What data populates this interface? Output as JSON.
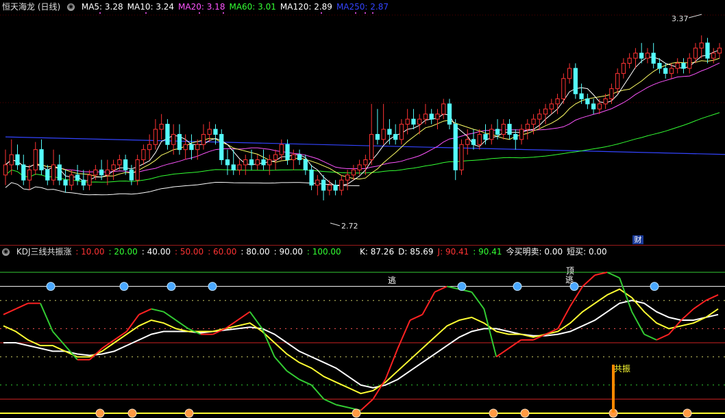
{
  "main_header": {
    "title": "恒天海龙 (日线)",
    "indicators": [
      {
        "label": "MA5: 3.28",
        "color": "#ffffff"
      },
      {
        "label": "MA10: 3.24",
        "color": "#ffffff"
      },
      {
        "label": "MA20: 3.18",
        "color": "#ff55ff"
      },
      {
        "label": "MA60: 3.01",
        "color": "#33ff33"
      },
      {
        "label": "MA120: 2.89",
        "color": "#ffffff"
      },
      {
        "label": "MA250: 2.87",
        "color": "#3344ff"
      }
    ]
  },
  "price_annotations": {
    "high": "3.37",
    "low": "2.72",
    "finance_badge": "财"
  },
  "kdj_header": {
    "title": "KDJ三线共振涨",
    "levels": [
      {
        "label": ": 10.00",
        "color": "#ff3333"
      },
      {
        "label": ": 20.00",
        "color": "#33ff33"
      },
      {
        "label": ": 40.00",
        "color": "#ffffff"
      },
      {
        "label": ": 50.00",
        "color": "#ff3333"
      },
      {
        "label": ": 60.00",
        "color": "#ff3333"
      },
      {
        "label": ": 80.00",
        "color": "#ffffff"
      },
      {
        "label": ": 90.00",
        "color": "#ffffff"
      },
      {
        "label": ": 100.00",
        "color": "#33ff33"
      }
    ],
    "values": [
      {
        "label": "K: 87.26",
        "color": "#ffffff"
      },
      {
        "label": "D: 85.69",
        "color": "#ffffff"
      },
      {
        "label": "J: 90.41",
        "color": "#ff3333"
      },
      {
        "label": ": 90.41",
        "color": "#33ff33"
      },
      {
        "label": "今买明卖: 0.00",
        "color": "#ffffff"
      },
      {
        "label": "短买: 0.00",
        "color": "#ffffff"
      }
    ]
  },
  "kdj_labels": {
    "escape": "逃",
    "top": "顶",
    "top_escape": "逃",
    "resonance": "共振"
  },
  "colors": {
    "up": "#ff3333",
    "down": "#55ffff",
    "ma5": "#ffffff",
    "ma10": "#ffff66",
    "ma20": "#ff55ff",
    "ma60": "#33ff33",
    "ma120": "#ffffff",
    "ma250": "#3344ff",
    "k": "#ffff33",
    "d": "#ffffff",
    "j": "#ff2222",
    "j_down": "#33cc33"
  },
  "chart_data": [
    {
      "type": "candlestick",
      "title": "恒天海龙 (日线)",
      "ylim": [
        2.62,
        3.45
      ],
      "series": [
        {
          "name": "MA250",
          "x": [
            0,
            139
          ],
          "values": [
            2.97,
            2.89
          ]
        }
      ],
      "candles": [
        {
          "o": 2.82,
          "h": 2.92,
          "l": 2.78,
          "c": 2.86
        },
        {
          "o": 2.86,
          "h": 2.96,
          "l": 2.82,
          "c": 2.9
        },
        {
          "o": 2.9,
          "h": 2.94,
          "l": 2.84,
          "c": 2.86
        },
        {
          "o": 2.86,
          "h": 2.9,
          "l": 2.78,
          "c": 2.8
        },
        {
          "o": 2.8,
          "h": 2.86,
          "l": 2.76,
          "c": 2.84
        },
        {
          "o": 2.84,
          "h": 2.95,
          "l": 2.82,
          "c": 2.92
        },
        {
          "o": 2.92,
          "h": 2.96,
          "l": 2.82,
          "c": 2.84
        },
        {
          "o": 2.84,
          "h": 2.86,
          "l": 2.78,
          "c": 2.8
        },
        {
          "o": 2.8,
          "h": 2.92,
          "l": 2.78,
          "c": 2.86
        },
        {
          "o": 2.86,
          "h": 2.9,
          "l": 2.78,
          "c": 2.8
        },
        {
          "o": 2.8,
          "h": 2.84,
          "l": 2.75,
          "c": 2.78
        },
        {
          "o": 2.78,
          "h": 2.84,
          "l": 2.76,
          "c": 2.82
        },
        {
          "o": 2.82,
          "h": 2.86,
          "l": 2.78,
          "c": 2.8
        },
        {
          "o": 2.8,
          "h": 2.84,
          "l": 2.76,
          "c": 2.78
        },
        {
          "o": 2.78,
          "h": 2.84,
          "l": 2.76,
          "c": 2.82
        },
        {
          "o": 2.82,
          "h": 2.86,
          "l": 2.8,
          "c": 2.84
        },
        {
          "o": 2.84,
          "h": 2.88,
          "l": 2.8,
          "c": 2.82
        },
        {
          "o": 2.82,
          "h": 2.88,
          "l": 2.78,
          "c": 2.84
        },
        {
          "o": 2.84,
          "h": 2.88,
          "l": 2.8,
          "c": 2.86
        },
        {
          "o": 2.86,
          "h": 2.9,
          "l": 2.84,
          "c": 2.88
        },
        {
          "o": 2.88,
          "h": 2.9,
          "l": 2.82,
          "c": 2.84
        },
        {
          "o": 2.84,
          "h": 2.86,
          "l": 2.78,
          "c": 2.8
        },
        {
          "o": 2.8,
          "h": 2.9,
          "l": 2.78,
          "c": 2.88
        },
        {
          "o": 2.88,
          "h": 2.94,
          "l": 2.86,
          "c": 2.92
        },
        {
          "o": 2.92,
          "h": 2.98,
          "l": 2.88,
          "c": 2.94
        },
        {
          "o": 2.94,
          "h": 3.04,
          "l": 2.92,
          "c": 3.0
        },
        {
          "o": 3.0,
          "h": 3.06,
          "l": 2.96,
          "c": 3.02
        },
        {
          "o": 3.02,
          "h": 3.04,
          "l": 2.92,
          "c": 2.94
        },
        {
          "o": 2.94,
          "h": 3.02,
          "l": 2.9,
          "c": 2.98
        },
        {
          "o": 2.98,
          "h": 3.02,
          "l": 2.9,
          "c": 2.92
        },
        {
          "o": 2.92,
          "h": 2.98,
          "l": 2.88,
          "c": 2.94
        },
        {
          "o": 2.94,
          "h": 2.98,
          "l": 2.88,
          "c": 2.92
        },
        {
          "o": 2.92,
          "h": 2.96,
          "l": 2.88,
          "c": 2.94
        },
        {
          "o": 2.94,
          "h": 3.02,
          "l": 2.92,
          "c": 2.98
        },
        {
          "o": 2.98,
          "h": 3.03,
          "l": 2.95,
          "c": 3.0
        },
        {
          "o": 3.0,
          "h": 3.02,
          "l": 2.94,
          "c": 2.98
        },
        {
          "o": 2.98,
          "h": 3.0,
          "l": 2.86,
          "c": 2.88
        },
        {
          "o": 2.88,
          "h": 2.92,
          "l": 2.82,
          "c": 2.86
        },
        {
          "o": 2.86,
          "h": 2.92,
          "l": 2.82,
          "c": 2.84
        },
        {
          "o": 2.84,
          "h": 2.88,
          "l": 2.82,
          "c": 2.86
        },
        {
          "o": 2.86,
          "h": 2.9,
          "l": 2.82,
          "c": 2.88
        },
        {
          "o": 2.88,
          "h": 2.92,
          "l": 2.84,
          "c": 2.86
        },
        {
          "o": 2.86,
          "h": 2.9,
          "l": 2.84,
          "c": 2.88
        },
        {
          "o": 2.88,
          "h": 2.92,
          "l": 2.84,
          "c": 2.86
        },
        {
          "o": 2.86,
          "h": 2.9,
          "l": 2.82,
          "c": 2.88
        },
        {
          "o": 2.88,
          "h": 2.92,
          "l": 2.84,
          "c": 2.9
        },
        {
          "o": 2.9,
          "h": 2.96,
          "l": 2.88,
          "c": 2.94
        },
        {
          "o": 2.94,
          "h": 2.96,
          "l": 2.86,
          "c": 2.88
        },
        {
          "o": 2.88,
          "h": 2.92,
          "l": 2.84,
          "c": 2.9
        },
        {
          "o": 2.9,
          "h": 2.92,
          "l": 2.86,
          "c": 2.88
        },
        {
          "o": 2.88,
          "h": 2.9,
          "l": 2.82,
          "c": 2.84
        },
        {
          "o": 2.84,
          "h": 2.86,
          "l": 2.76,
          "c": 2.78
        },
        {
          "o": 2.78,
          "h": 2.82,
          "l": 2.74,
          "c": 2.8
        },
        {
          "o": 2.8,
          "h": 2.82,
          "l": 2.72,
          "c": 2.76
        },
        {
          "o": 2.76,
          "h": 2.8,
          "l": 2.74,
          "c": 2.78
        },
        {
          "o": 2.78,
          "h": 2.8,
          "l": 2.74,
          "c": 2.76
        },
        {
          "o": 2.76,
          "h": 2.82,
          "l": 2.74,
          "c": 2.8
        },
        {
          "o": 2.8,
          "h": 2.84,
          "l": 2.76,
          "c": 2.82
        },
        {
          "o": 2.82,
          "h": 2.86,
          "l": 2.8,
          "c": 2.84
        },
        {
          "o": 2.84,
          "h": 2.88,
          "l": 2.82,
          "c": 2.86
        },
        {
          "o": 2.86,
          "h": 2.9,
          "l": 2.82,
          "c": 2.88
        },
        {
          "o": 2.88,
          "h": 3.1,
          "l": 2.86,
          "c": 2.98
        },
        {
          "o": 2.98,
          "h": 3.08,
          "l": 2.94,
          "c": 2.96
        },
        {
          "o": 2.96,
          "h": 3.1,
          "l": 2.94,
          "c": 3.0
        },
        {
          "o": 3.0,
          "h": 3.04,
          "l": 2.94,
          "c": 2.98
        },
        {
          "o": 2.98,
          "h": 3.02,
          "l": 2.94,
          "c": 2.96
        },
        {
          "o": 2.96,
          "h": 3.04,
          "l": 2.94,
          "c": 3.02
        },
        {
          "o": 3.02,
          "h": 3.08,
          "l": 2.98,
          "c": 3.04
        },
        {
          "o": 3.04,
          "h": 3.08,
          "l": 3.0,
          "c": 3.02
        },
        {
          "o": 3.02,
          "h": 3.06,
          "l": 2.98,
          "c": 3.04
        },
        {
          "o": 3.04,
          "h": 3.1,
          "l": 3.02,
          "c": 3.06
        },
        {
          "o": 3.06,
          "h": 3.08,
          "l": 3.02,
          "c": 3.04
        },
        {
          "o": 3.04,
          "h": 3.08,
          "l": 3.0,
          "c": 3.06
        },
        {
          "o": 3.06,
          "h": 3.12,
          "l": 3.04,
          "c": 3.1
        },
        {
          "o": 3.1,
          "h": 3.12,
          "l": 3.0,
          "c": 3.02
        },
        {
          "o": 3.02,
          "h": 3.04,
          "l": 2.8,
          "c": 2.84
        },
        {
          "o": 2.84,
          "h": 2.96,
          "l": 2.82,
          "c": 2.94
        },
        {
          "o": 2.94,
          "h": 3.0,
          "l": 2.9,
          "c": 2.96
        },
        {
          "o": 2.96,
          "h": 3.0,
          "l": 2.92,
          "c": 2.94
        },
        {
          "o": 2.94,
          "h": 3.0,
          "l": 2.92,
          "c": 2.98
        },
        {
          "o": 2.98,
          "h": 3.02,
          "l": 2.94,
          "c": 2.96
        },
        {
          "o": 2.96,
          "h": 3.02,
          "l": 2.94,
          "c": 3.0
        },
        {
          "o": 3.0,
          "h": 3.04,
          "l": 2.96,
          "c": 2.98
        },
        {
          "o": 2.98,
          "h": 3.04,
          "l": 2.96,
          "c": 3.02
        },
        {
          "o": 3.02,
          "h": 3.04,
          "l": 2.96,
          "c": 2.98
        },
        {
          "o": 2.98,
          "h": 3.0,
          "l": 2.92,
          "c": 2.96
        },
        {
          "o": 2.96,
          "h": 3.02,
          "l": 2.94,
          "c": 3.0
        },
        {
          "o": 3.0,
          "h": 3.04,
          "l": 2.96,
          "c": 3.02
        },
        {
          "o": 3.02,
          "h": 3.06,
          "l": 2.98,
          "c": 3.04
        },
        {
          "o": 3.04,
          "h": 3.08,
          "l": 3.0,
          "c": 3.06
        },
        {
          "o": 3.06,
          "h": 3.1,
          "l": 3.02,
          "c": 3.08
        },
        {
          "o": 3.08,
          "h": 3.12,
          "l": 3.06,
          "c": 3.1
        },
        {
          "o": 3.1,
          "h": 3.14,
          "l": 3.06,
          "c": 3.12
        },
        {
          "o": 3.12,
          "h": 3.22,
          "l": 3.1,
          "c": 3.2
        },
        {
          "o": 3.2,
          "h": 3.26,
          "l": 3.18,
          "c": 3.24
        },
        {
          "o": 3.24,
          "h": 3.26,
          "l": 3.12,
          "c": 3.14
        },
        {
          "o": 3.14,
          "h": 3.18,
          "l": 3.1,
          "c": 3.12
        },
        {
          "o": 3.12,
          "h": 3.14,
          "l": 3.08,
          "c": 3.1
        },
        {
          "o": 3.1,
          "h": 3.12,
          "l": 3.06,
          "c": 3.08
        },
        {
          "o": 3.08,
          "h": 3.12,
          "l": 3.06,
          "c": 3.1
        },
        {
          "o": 3.1,
          "h": 3.14,
          "l": 3.08,
          "c": 3.12
        },
        {
          "o": 3.12,
          "h": 3.18,
          "l": 3.1,
          "c": 3.16
        },
        {
          "o": 3.16,
          "h": 3.24,
          "l": 3.14,
          "c": 3.22
        },
        {
          "o": 3.22,
          "h": 3.28,
          "l": 3.2,
          "c": 3.26
        },
        {
          "o": 3.26,
          "h": 3.3,
          "l": 3.24,
          "c": 3.28
        },
        {
          "o": 3.28,
          "h": 3.32,
          "l": 3.24,
          "c": 3.3
        },
        {
          "o": 3.3,
          "h": 3.34,
          "l": 3.26,
          "c": 3.28
        },
        {
          "o": 3.28,
          "h": 3.32,
          "l": 3.26,
          "c": 3.3
        },
        {
          "o": 3.3,
          "h": 3.34,
          "l": 3.24,
          "c": 3.26
        },
        {
          "o": 3.26,
          "h": 3.28,
          "l": 3.22,
          "c": 3.24
        },
        {
          "o": 3.24,
          "h": 3.26,
          "l": 3.2,
          "c": 3.22
        },
        {
          "o": 3.22,
          "h": 3.26,
          "l": 3.2,
          "c": 3.24
        },
        {
          "o": 3.24,
          "h": 3.28,
          "l": 3.22,
          "c": 3.26
        },
        {
          "o": 3.26,
          "h": 3.28,
          "l": 3.22,
          "c": 3.24
        },
        {
          "o": 3.24,
          "h": 3.3,
          "l": 3.22,
          "c": 3.28
        },
        {
          "o": 3.28,
          "h": 3.34,
          "l": 3.26,
          "c": 3.32
        },
        {
          "o": 3.32,
          "h": 3.37,
          "l": 3.28,
          "c": 3.34
        },
        {
          "o": 3.34,
          "h": 3.36,
          "l": 3.26,
          "c": 3.28
        },
        {
          "o": 3.28,
          "h": 3.32,
          "l": 3.26,
          "c": 3.3
        },
        {
          "o": 3.3,
          "h": 3.34,
          "l": 3.28,
          "c": 3.32
        }
      ]
    },
    {
      "type": "line",
      "title": "KDJ三线共振涨",
      "ylim": [
        0,
        100
      ],
      "series": [
        {
          "name": "K",
          "values": [
            62,
            58,
            52,
            48,
            48,
            44,
            40,
            40,
            44,
            50,
            56,
            62,
            66,
            64,
            60,
            58,
            58,
            58,
            60,
            62,
            64,
            58,
            50,
            42,
            36,
            32,
            26,
            22,
            18,
            14,
            16,
            22,
            30,
            38,
            46,
            54,
            62,
            66,
            68,
            64,
            58,
            56,
            56,
            54,
            56,
            58,
            64,
            72,
            78,
            84,
            88,
            82,
            72,
            64,
            60,
            62,
            64,
            68,
            74
          ]
        },
        {
          "name": "D",
          "values": [
            50,
            50,
            48,
            46,
            44,
            44,
            42,
            41,
            42,
            44,
            48,
            52,
            56,
            58,
            58,
            58,
            57,
            58,
            59,
            60,
            61,
            60,
            56,
            50,
            44,
            40,
            36,
            32,
            26,
            20,
            18,
            20,
            24,
            30,
            36,
            42,
            48,
            54,
            58,
            60,
            60,
            58,
            56,
            55,
            55,
            56,
            58,
            62,
            66,
            72,
            78,
            80,
            78,
            72,
            68,
            66,
            66,
            68,
            70
          ]
        },
        {
          "name": "J",
          "values": [
            70,
            74,
            78,
            78,
            58,
            48,
            38,
            38,
            46,
            52,
            58,
            70,
            74,
            72,
            66,
            60,
            56,
            56,
            60,
            66,
            72,
            60,
            40,
            30,
            24,
            20,
            10,
            6,
            4,
            2,
            10,
            24,
            46,
            66,
            70,
            86,
            90,
            88,
            86,
            74,
            40,
            46,
            52,
            52,
            56,
            60,
            76,
            90,
            98,
            100,
            96,
            72,
            56,
            52,
            56,
            66,
            74,
            80,
            84
          ]
        }
      ]
    }
  ]
}
